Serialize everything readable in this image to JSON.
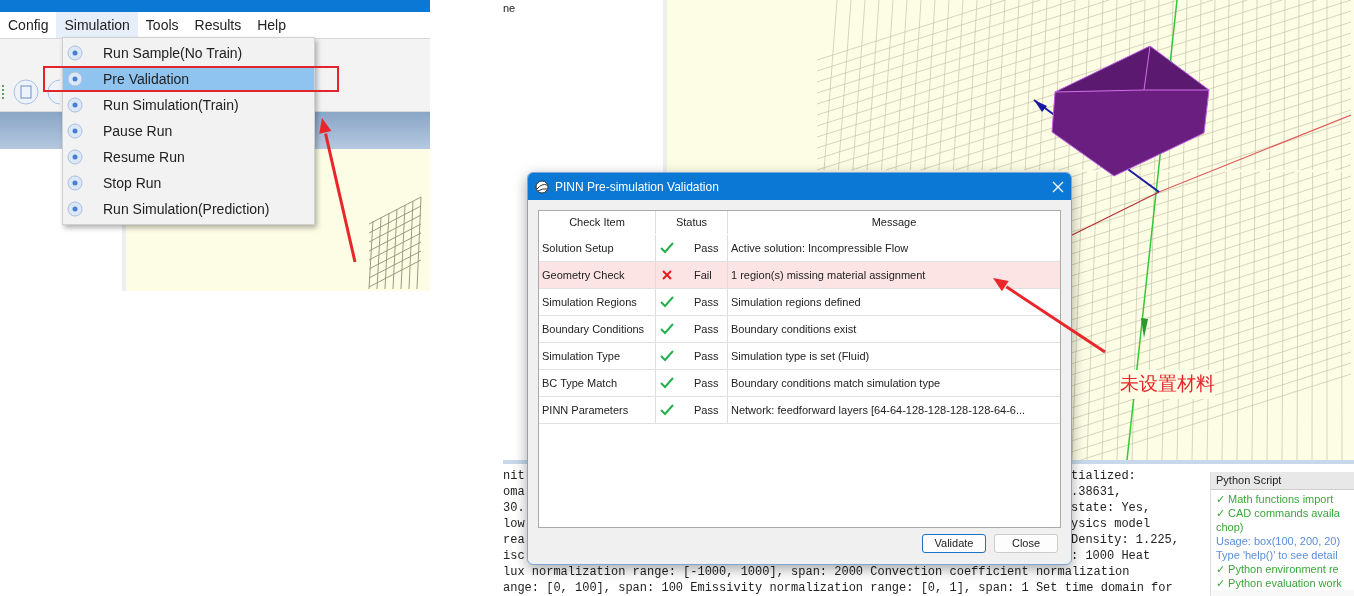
{
  "left_window": {
    "menubar": [
      {
        "label": "Config",
        "selected": false
      },
      {
        "label": "Simulation",
        "selected": true
      },
      {
        "label": "Tools",
        "selected": false
      },
      {
        "label": "Results",
        "selected": false
      },
      {
        "label": "Help",
        "selected": false
      }
    ],
    "menu": [
      {
        "label": "Run Sample(No Train)",
        "selected": false
      },
      {
        "label": "Pre Validation",
        "selected": true
      },
      {
        "label": "Run Simulation(Train)",
        "selected": false
      },
      {
        "label": "Pause Run",
        "selected": false
      },
      {
        "label": "Resume Run",
        "selected": false
      },
      {
        "label": "Stop Run",
        "selected": false
      },
      {
        "label": "Run Simulation(Prediction)",
        "selected": false
      }
    ]
  },
  "right_window": {
    "tree_text": "ne",
    "dialog": {
      "title": "PINN Pre-simulation Validation",
      "columns": [
        "Check Item",
        "Status",
        "Message"
      ],
      "rows": [
        {
          "item": "Solution Setup",
          "passed": true,
          "status": "Pass",
          "message": "Active solution: Incompressible Flow"
        },
        {
          "item": "Geometry Check",
          "passed": false,
          "status": "Fail",
          "message": "1 region(s) missing material assignment"
        },
        {
          "item": "Simulation Regions",
          "passed": true,
          "status": "Pass",
          "message": "Simulation regions defined"
        },
        {
          "item": "Boundary Conditions",
          "passed": true,
          "status": "Pass",
          "message": "Boundary conditions exist"
        },
        {
          "item": "Simulation Type",
          "passed": true,
          "status": "Pass",
          "message": "Simulation type is set (Fluid)"
        },
        {
          "item": "BC Type Match",
          "passed": true,
          "status": "Pass",
          "message": "Boundary conditions match simulation type"
        },
        {
          "item": "PINN Parameters",
          "passed": true,
          "status": "Pass",
          "message": "Network: feedforward layers [64-64-128-128-128-128-64-6..."
        }
      ],
      "buttons": [
        "Validate",
        "Close"
      ]
    },
    "console": [
      [
        "nit",
        "tialized:"
      ],
      [
        "oma",
        ".38631,"
      ],
      [
        "30.",
        "state: Yes,"
      ],
      [
        "low",
        "ysics model"
      ],
      [
        "rea",
        "Density: 1.225,"
      ],
      [
        "isc",
        ": 1000 Heat"
      ],
      [
        "lux normalization range: [-1000, 1000], span: 2000 Convection coefficient normalization"
      ],
      [
        "ange: [0, 100], span: 100 Emissivity normalization range: [0, 1], span: 1 Set time domain for"
      ]
    ],
    "python_panel": {
      "title": "Python Script",
      "lines": [
        {
          "kind": "ok",
          "text": "✓ Math functions import"
        },
        {
          "kind": "ok",
          "text": "✓ CAD commands availa"
        },
        {
          "kind": "ok",
          "text": "chop)"
        },
        {
          "kind": "info",
          "text": "Usage: box(100, 200, 20)"
        },
        {
          "kind": "info",
          "text": "Type 'help()' to see detail"
        },
        {
          "kind": "ok",
          "text": "✓ Python environment re"
        },
        {
          "kind": "ok",
          "text": "✓ Python evaluation work"
        }
      ]
    },
    "annotation": "未设置材料"
  }
}
